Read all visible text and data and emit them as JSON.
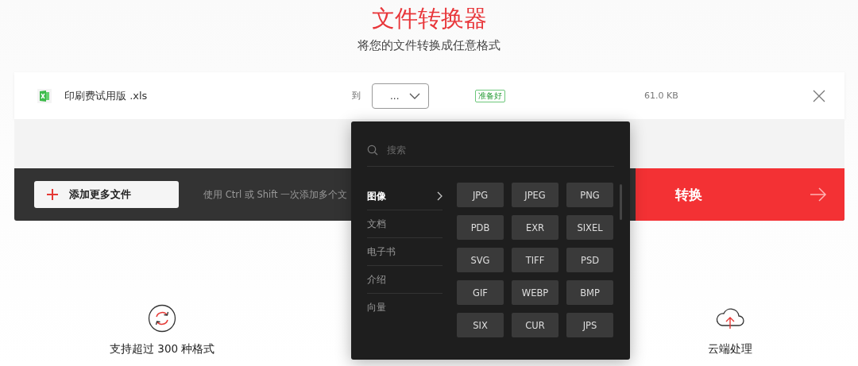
{
  "header": {
    "title": "文件转换器",
    "subtitle": "将您的文件转换成任意格式"
  },
  "file": {
    "name": "印刷费试用版 .xls",
    "to_label": "到",
    "format_value": "...",
    "status": "准备好",
    "size": "61.0 KB"
  },
  "actions": {
    "add_button": "添加更多文件",
    "hint": "使用 Ctrl 或 Shift 一次添加多个文",
    "convert_button": "转换"
  },
  "dropdown": {
    "search": {
      "placeholder": "搜索"
    },
    "categories": [
      {
        "label": "图像",
        "selected": true
      },
      {
        "label": "文档",
        "selected": false
      },
      {
        "label": "电子书",
        "selected": false
      },
      {
        "label": "介绍",
        "selected": false
      },
      {
        "label": "向量",
        "selected": false
      }
    ],
    "formats": [
      "JPG",
      "JPEG",
      "PNG",
      "PDB",
      "EXR",
      "SIXEL",
      "SVG",
      "TIFF",
      "PSD",
      "GIF",
      "WEBP",
      "BMP",
      "SIX",
      "CUR",
      "JPS"
    ]
  },
  "features": [
    {
      "kind": "formats",
      "label": "支持超过 300 种格式"
    },
    {
      "kind": "cloud",
      "label": "云端处理"
    }
  ]
}
